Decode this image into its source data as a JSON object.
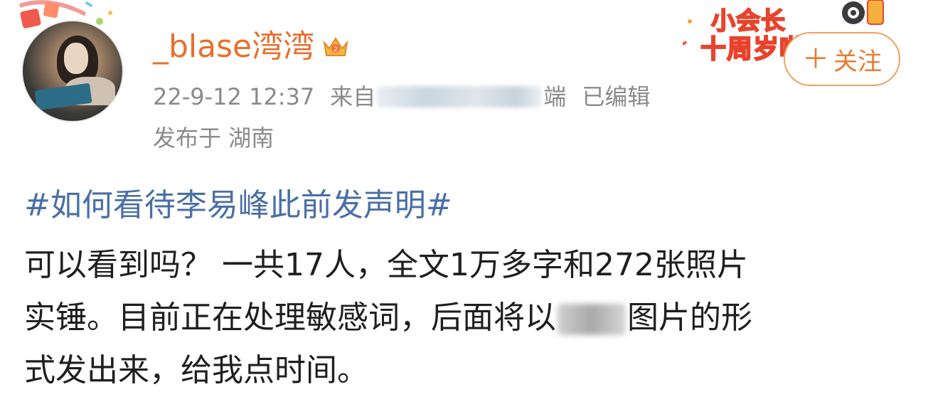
{
  "post": {
    "username": "_blase湾湾",
    "crown_icon": "crown-icon",
    "timestamp": "22-9-12 12:37",
    "source_prefix": "来自",
    "source_suffix": "端",
    "edited_label": "已编辑",
    "location": "发布于 湖南",
    "hashtag": "#如何看待李易峰此前发声明#",
    "content_line1": "可以看到吗？ 一共17人，全文1万多字和272张照片",
    "content_line2a": "实锤。目前正在处理敏感词，后面将以",
    "content_line2b": "图片的形",
    "content_line3": "式发出来，给我点时间。"
  },
  "follow_button": {
    "label": "关注",
    "icon": "plus-icon"
  },
  "badge": {
    "line1": "小会长",
    "line2": "十周岁啦"
  },
  "colors": {
    "username": "#e86f2d",
    "hashtag": "#4a6fa5",
    "meta": "#8a8a8a",
    "follow_border": "#f0a25e"
  }
}
